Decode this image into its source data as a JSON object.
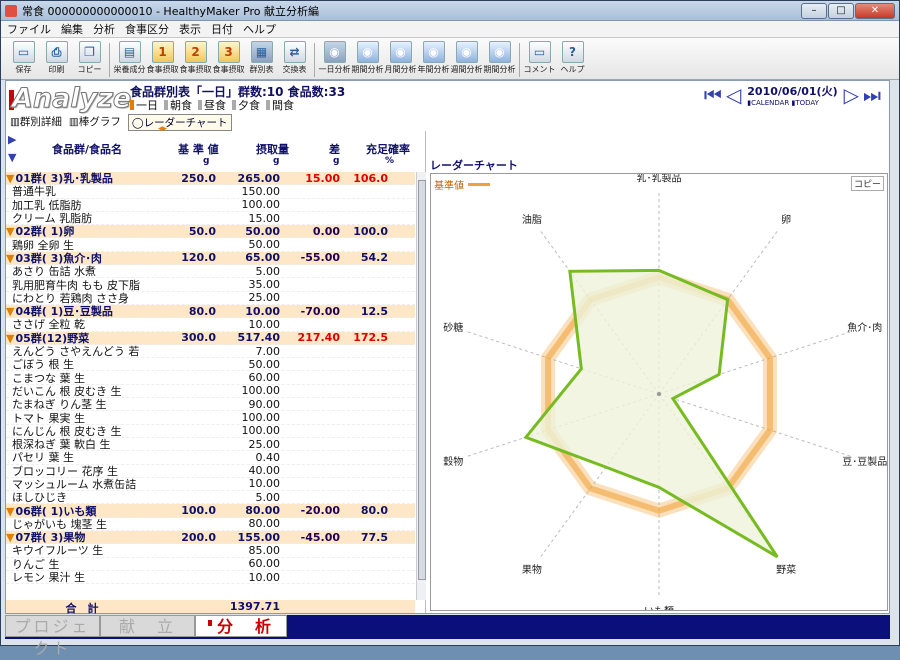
{
  "window": {
    "title": "常食 000000000000010 - HealthyMaker Pro 献立分析編",
    "min": "–",
    "max": "□",
    "close": "✕"
  },
  "menu": [
    "ファイル",
    "編集",
    "分析",
    "食事区分",
    "表示",
    "日付",
    "ヘルプ"
  ],
  "toolbar": [
    {
      "label": "保存",
      "icon": "save-icon",
      "g": "▭"
    },
    {
      "label": "印刷",
      "icon": "print-icon",
      "g": "⎙"
    },
    {
      "label": "コピー",
      "icon": "copy-icon",
      "g": "❐"
    },
    {
      "label": "栄養成分",
      "icon": "nutrition-icon",
      "g": "▤"
    },
    {
      "label": "食事摂取",
      "icon": "intake-1-icon",
      "g": "1",
      "num": true
    },
    {
      "label": "食事摂取",
      "icon": "intake-2-icon",
      "g": "2",
      "num": true
    },
    {
      "label": "食事摂取",
      "icon": "intake-3-icon",
      "g": "3",
      "num": true
    },
    {
      "label": "群別表",
      "icon": "group-table-icon",
      "g": "▦",
      "active": true
    },
    {
      "label": "交換表",
      "icon": "exchange-table-icon",
      "g": "⇄"
    },
    {
      "label": "一日分析",
      "icon": "day-analysis-icon",
      "g": "◉",
      "blue": true,
      "active": true
    },
    {
      "label": "期間分析",
      "icon": "period-analysis-icon",
      "g": "◉",
      "blue": true
    },
    {
      "label": "月間分析",
      "icon": "month-analysis-icon",
      "g": "◉",
      "blue": true
    },
    {
      "label": "年間分析",
      "icon": "year-analysis-icon",
      "g": "◉",
      "blue": true
    },
    {
      "label": "週間分析",
      "icon": "week-analysis-icon",
      "g": "◉",
      "blue": true
    },
    {
      "label": "期間分析",
      "icon": "period-analysis-2-icon",
      "g": "◉",
      "blue": true
    },
    {
      "label": "コメント",
      "icon": "comment-icon",
      "g": "▭"
    },
    {
      "label": "ヘルプ",
      "icon": "help-icon",
      "g": "?"
    }
  ],
  "header": {
    "logo": "Analyze",
    "title": "食品群別表「一日」群数:10 食品数:33",
    "meal_tabs": [
      {
        "label": "一日",
        "on": true
      },
      {
        "label": "朝食"
      },
      {
        "label": "昼食"
      },
      {
        "label": "夕食"
      },
      {
        "label": "間食"
      }
    ],
    "subtabs": [
      "群別詳細",
      "棒グラフ",
      "レーダーチャート"
    ],
    "date": "2010/06/01(火)",
    "date_sub": "▮CALENDAR ▮TODAY"
  },
  "table": {
    "headers": {
      "name": "食品群/食品名",
      "base": "基 準 値",
      "base_unit": "g",
      "intake": "摂取量",
      "intake_unit": "g",
      "diff": "差",
      "diff_unit": "g",
      "rate": "充足確率",
      "rate_unit": "%"
    },
    "rows": [
      {
        "g": 1,
        "n": "01群( 3)乳･乳製品",
        "b": "250.0",
        "i": "265.00",
        "d": "15.00",
        "r": "106.0",
        "dc": "red",
        "rc": "red"
      },
      {
        "n": "普通牛乳",
        "i": "150.00"
      },
      {
        "n": "加工乳 低脂肪",
        "i": "100.00"
      },
      {
        "n": "クリーム 乳脂肪",
        "i": "15.00"
      },
      {
        "g": 1,
        "n": "02群( 1)卵",
        "b": "50.0",
        "i": "50.00",
        "d": "0.00",
        "r": "100.0"
      },
      {
        "n": "鶏卵 全卵 生",
        "i": "50.00"
      },
      {
        "g": 1,
        "n": "03群( 3)魚介･肉",
        "b": "120.0",
        "i": "65.00",
        "d": "-55.00",
        "r": "54.2"
      },
      {
        "n": "あさり 缶詰 水煮",
        "i": "5.00"
      },
      {
        "n": "乳用肥育牛肉 もも 皮下脂",
        "i": "35.00"
      },
      {
        "n": "にわとり 若鶏肉 ささ身",
        "i": "25.00"
      },
      {
        "g": 1,
        "n": "04群( 1)豆･豆製品",
        "b": "80.0",
        "i": "10.00",
        "d": "-70.00",
        "r": "12.5"
      },
      {
        "n": "ささげ 全粒 乾",
        "i": "10.00"
      },
      {
        "g": 1,
        "n": "05群(12)野菜",
        "b": "300.0",
        "i": "517.40",
        "d": "217.40",
        "r": "172.5",
        "dc": "red",
        "rc": "red"
      },
      {
        "n": "えんどう さやえんどう 若",
        "i": "7.00"
      },
      {
        "n": "ごぼう 根 生",
        "i": "50.00"
      },
      {
        "n": "こまつな 葉 生",
        "i": "60.00"
      },
      {
        "n": "だいこん 根 皮むき 生",
        "i": "100.00"
      },
      {
        "n": "たまねぎ りん茎 生",
        "i": "90.00"
      },
      {
        "n": "トマト 果実 生",
        "i": "100.00"
      },
      {
        "n": "にんじん 根 皮むき 生",
        "i": "100.00"
      },
      {
        "n": "根深ねぎ 葉 軟白 生",
        "i": "25.00"
      },
      {
        "n": "パセリ 葉 生",
        "i": "0.40"
      },
      {
        "n": "ブロッコリー 花序 生",
        "i": "40.00"
      },
      {
        "n": "マッシュルーム 水煮缶詰",
        "i": "10.00"
      },
      {
        "n": "ほしひじき",
        "i": "5.00"
      },
      {
        "g": 1,
        "n": "06群( 1)いも類",
        "b": "100.0",
        "i": "80.00",
        "d": "-20.00",
        "r": "80.0"
      },
      {
        "n": "じゃがいも 塊茎 生",
        "i": "80.00"
      },
      {
        "g": 1,
        "n": "07群( 3)果物",
        "b": "200.0",
        "i": "155.00",
        "d": "-45.00",
        "r": "77.5"
      },
      {
        "n": "キウイフルーツ 生",
        "i": "85.00"
      },
      {
        "n": "りんご 生",
        "i": "60.00"
      },
      {
        "n": "レモン 果汁 生",
        "i": "10.00"
      }
    ],
    "total_label": "合　計",
    "total_value": "1397.71"
  },
  "radar": {
    "title": "レーダーチャート",
    "legend": "基準値",
    "copy": "コピー",
    "axes": [
      "乳･乳製品",
      "卵",
      "魚介･肉",
      "豆･豆製品",
      "野菜",
      "いも類",
      "果物",
      "穀物",
      "砂糖",
      "油脂"
    ],
    "intake_pct": [
      106.0,
      100.0,
      54.2,
      12.5,
      172.5,
      80.0,
      77.5,
      120.0,
      70.0,
      130.0
    ],
    "base_pct": 100,
    "max_pct": 180,
    "colors": {
      "intake_line": "#77bb22",
      "intake_fill": "#eef3da",
      "base": "#f2a540"
    }
  },
  "bottom_tabs": [
    {
      "label": "プロジェクト"
    },
    {
      "label": "献　立"
    },
    {
      "label": "分　析",
      "on": true
    }
  ]
}
